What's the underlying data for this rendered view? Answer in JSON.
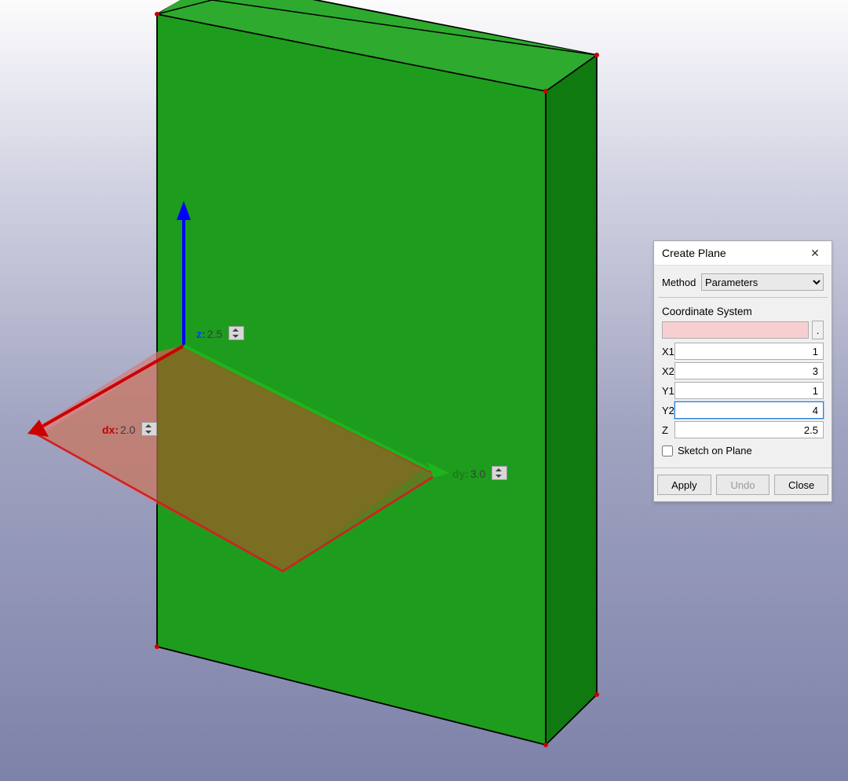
{
  "dialog": {
    "title": "Create Plane",
    "method_label": "Method",
    "method_value": "Parameters",
    "coord_section_label": "Coordinate System",
    "coord_input_value": "",
    "dot_button_label": ".",
    "params": [
      {
        "label": "X1",
        "value": "1"
      },
      {
        "label": "X2",
        "value": "3"
      },
      {
        "label": "Y1",
        "value": "1"
      },
      {
        "label": "Y2",
        "value": "4"
      },
      {
        "label": "Z",
        "value": "2.5"
      }
    ],
    "checkbox_label": "Sketch on Plane",
    "checkbox_checked": false,
    "buttons": {
      "apply": "Apply",
      "undo": "Undo",
      "close": "Close"
    }
  },
  "scene": {
    "axis_labels": {
      "z": {
        "letter": "z:",
        "value": "2.5"
      },
      "x": {
        "letter": "dx:",
        "value": "2.0"
      },
      "y": {
        "letter": "dy:",
        "value": "3.0"
      }
    },
    "colors": {
      "box_front": "#1e9c1e",
      "box_top": "#2eaa2e",
      "box_side": "#0f7a0f",
      "plane_fill_light": "rgba(213,120,120,0.55)",
      "plane_fill_dark": "rgba(150,100,40,0.60)",
      "plane_border": "#d02020",
      "axis_z": "#0000ff",
      "axis_x": "#cc0000",
      "axis_y": "#1db41d"
    }
  }
}
